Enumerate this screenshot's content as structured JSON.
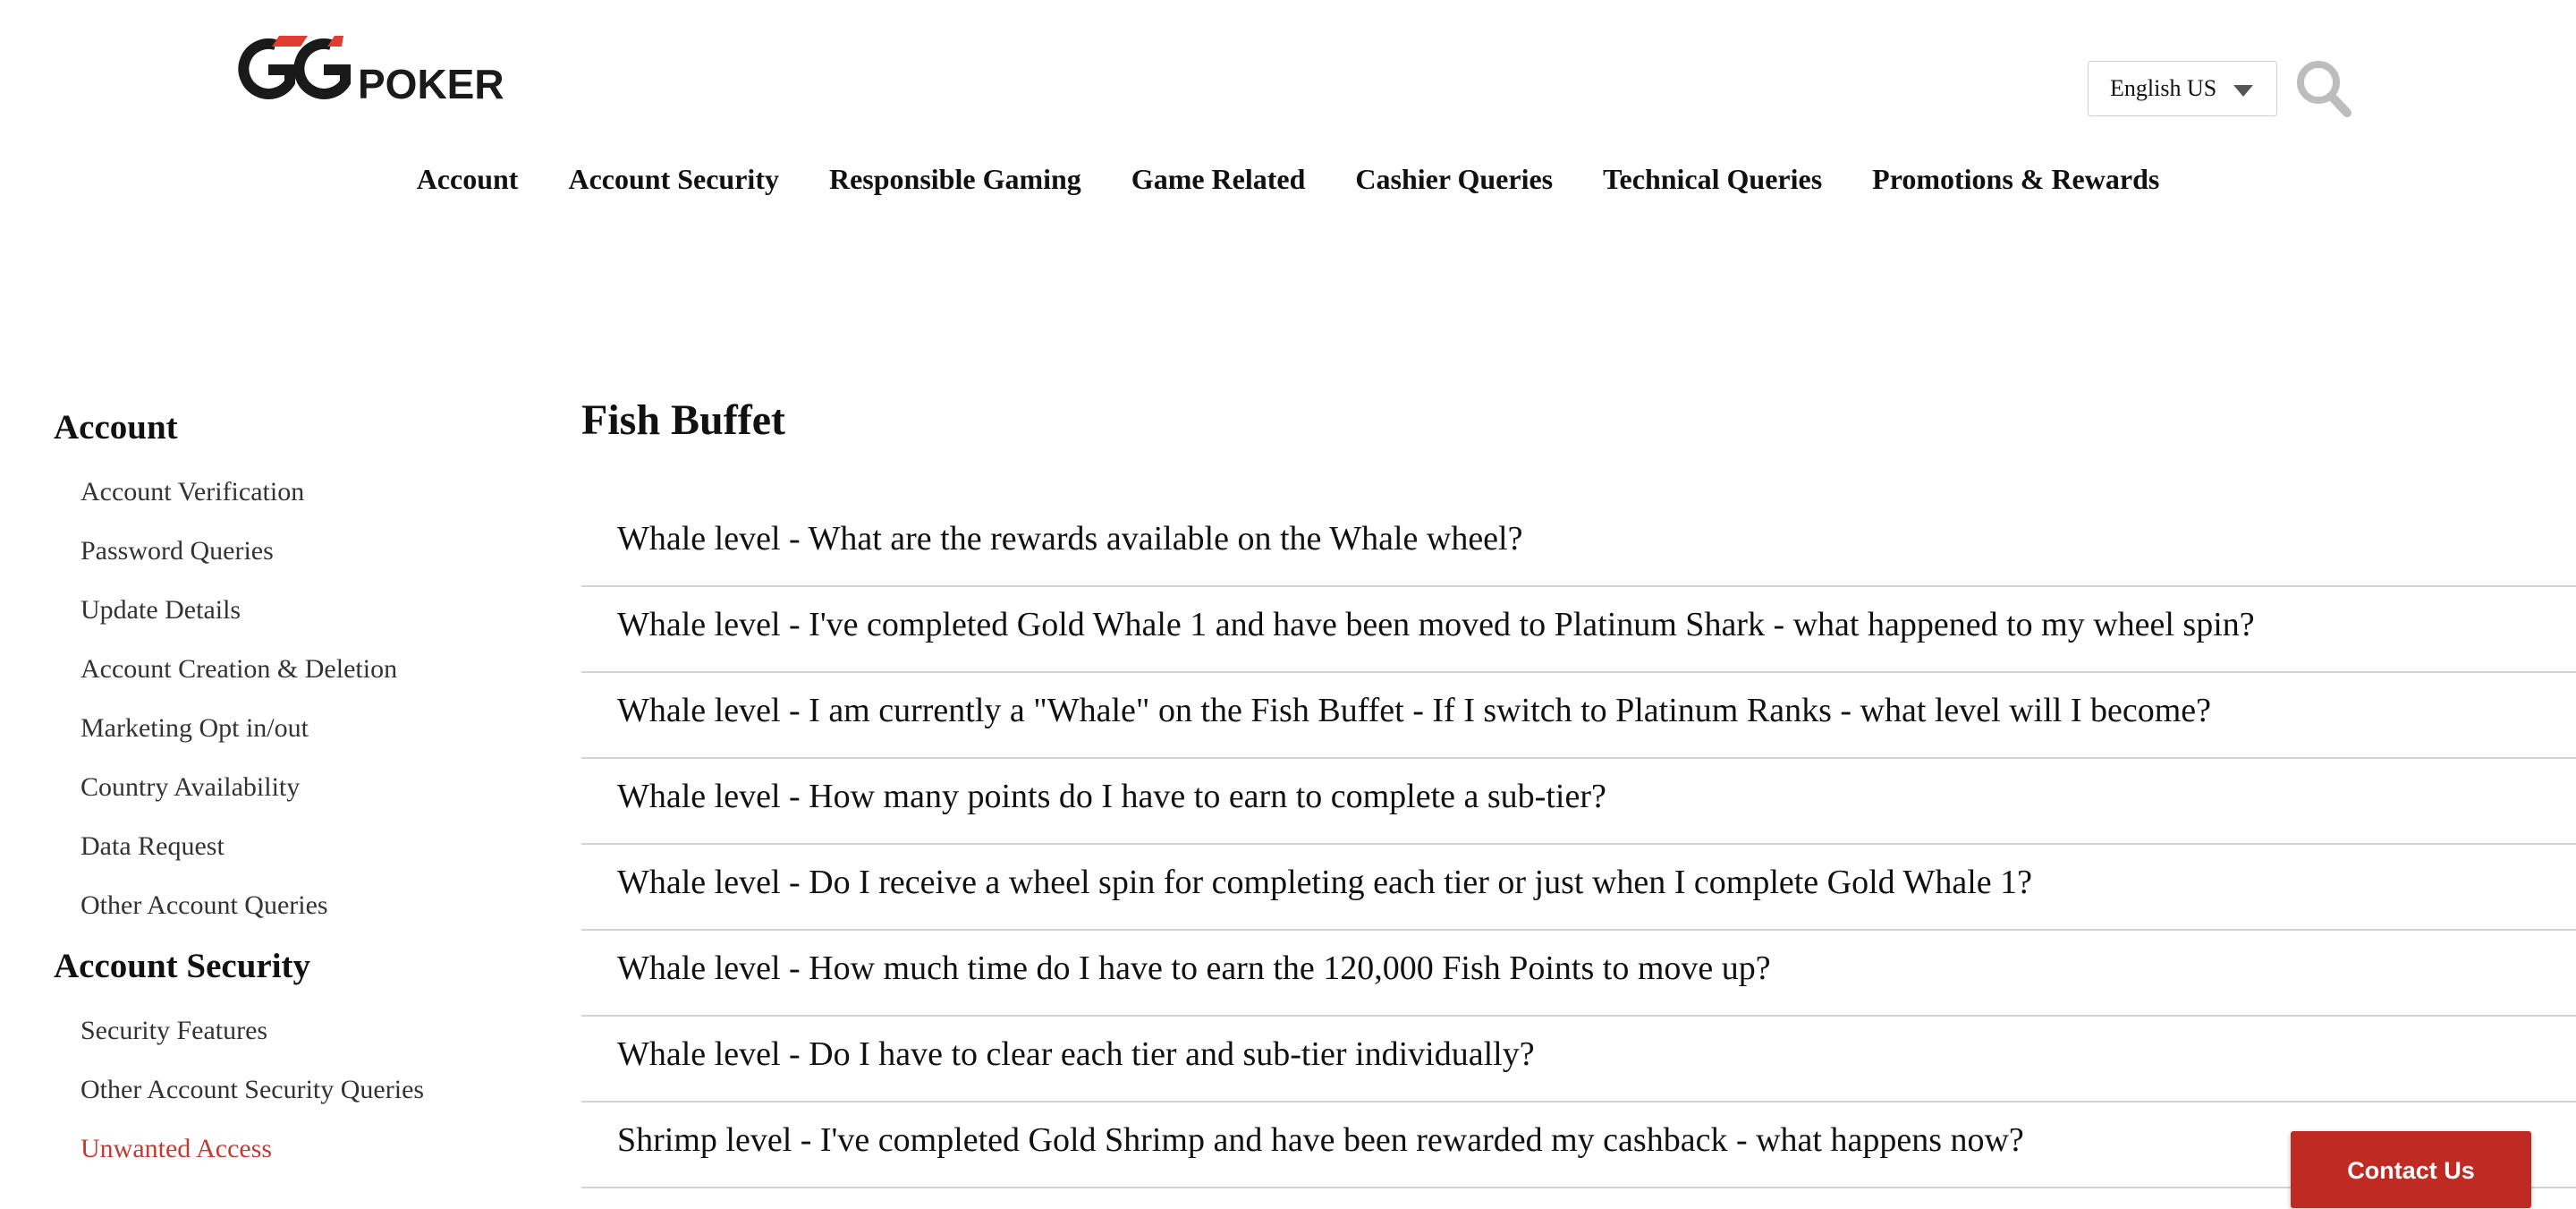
{
  "logo": {
    "text": "GGPOKER",
    "brand_red": "#e03c31",
    "brand_dark": "#1a1a1a"
  },
  "header": {
    "language_selected": "English US",
    "search_icon": "magnifier-icon"
  },
  "nav": {
    "items": [
      "Account",
      "Account Security",
      "Responsible Gaming",
      "Game Related",
      "Cashier Queries",
      "Technical Queries",
      "Promotions & Rewards"
    ]
  },
  "sidebar": {
    "sections": [
      {
        "heading": "Account",
        "items": [
          "Account Verification",
          "Password Queries",
          "Update Details",
          "Account Creation & Deletion",
          "Marketing Opt in/out",
          "Country Availability",
          "Data Request",
          "Other Account Queries"
        ]
      },
      {
        "heading": "Account Security",
        "items": [
          "Security Features",
          "Other Account Security Queries",
          "Unwanted Access"
        ]
      }
    ],
    "active_item": "Unwanted Access",
    "active_color": "#c23b33"
  },
  "main": {
    "title": "Fish Buffet",
    "faqs": [
      "Whale level - What are the rewards available on the Whale wheel?",
      "Whale level - I've completed Gold Whale 1 and have been moved to Platinum Shark - what happened to my wheel spin?",
      "Whale level - I am currently a \"Whale\" on the Fish Buffet - If I switch to Platinum Ranks - what level will I become?",
      "Whale level - How many points do I have to earn to complete a sub-tier?",
      "Whale level - Do I receive a wheel spin for completing each tier or just when I complete Gold Whale 1?",
      "Whale level - How much time do I have to earn the 120,000 Fish Points to move up?",
      "Whale level - Do I have to clear each tier and sub-tier individually?",
      "Shrimp level - I've completed Gold Shrimp and have been rewarded my cashback - what happens now?"
    ]
  },
  "contact": {
    "label": "Contact Us",
    "color": "#bf2b22"
  }
}
